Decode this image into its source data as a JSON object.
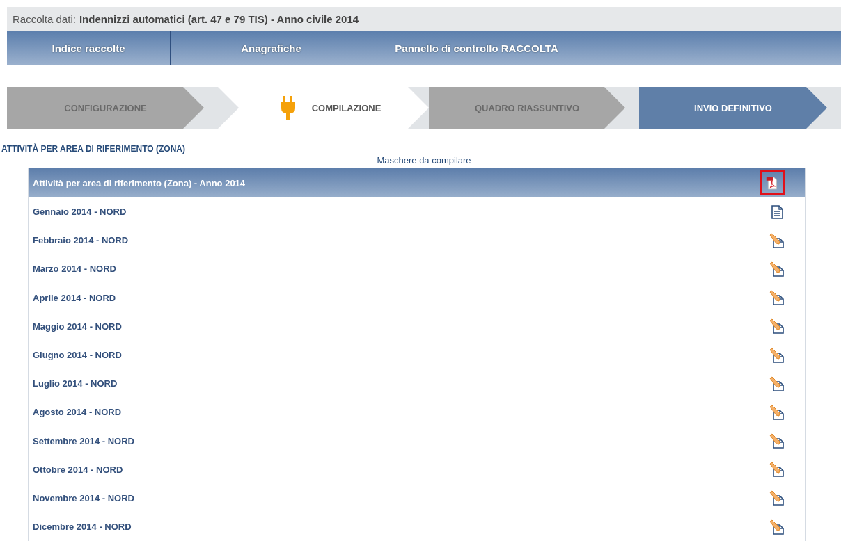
{
  "header": {
    "label": "Raccolta dati:",
    "title": "Indennizzi automatici (art. 47 e 79 TIS) - Anno civile 2014"
  },
  "nav": [
    {
      "label": "Indice raccolte"
    },
    {
      "label": "Anagrafiche"
    },
    {
      "label": "Pannello di controllo RACCOLTA"
    }
  ],
  "steps": [
    {
      "label": "CONFIGURAZIONE",
      "kind": "done"
    },
    {
      "label": "COMPILAZIONE",
      "kind": "current"
    },
    {
      "label": "QUADRO RIASSUNTIVO",
      "kind": "done"
    },
    {
      "label": "INVIO DEFINITIVO",
      "kind": "final"
    }
  ],
  "section_title": "ATTIVITÀ PER AREA DI RIFERIMENTO (ZONA)",
  "table": {
    "caption": "Maschere da compilare",
    "title": "Attività per area di riferimento (Zona) - Anno 2014",
    "highlighted": true,
    "rows": [
      {
        "label": "Gennaio 2014 - NORD",
        "kind": "view"
      },
      {
        "label": "Febbraio 2014 - NORD",
        "kind": "edit"
      },
      {
        "label": "Marzo 2014 - NORD",
        "kind": "edit"
      },
      {
        "label": "Aprile 2014 - NORD",
        "kind": "edit"
      },
      {
        "label": "Maggio 2014 - NORD",
        "kind": "edit"
      },
      {
        "label": "Giugno 2014 - NORD",
        "kind": "edit"
      },
      {
        "label": "Luglio 2014 - NORD",
        "kind": "edit"
      },
      {
        "label": "Agosto 2014 - NORD",
        "kind": "edit"
      },
      {
        "label": "Settembre 2014 - NORD",
        "kind": "edit"
      },
      {
        "label": "Ottobre 2014 - NORD",
        "kind": "edit"
      },
      {
        "label": "Novembre 2014 - NORD",
        "kind": "edit"
      },
      {
        "label": "Dicembre 2014 - NORD",
        "kind": "edit"
      }
    ]
  }
}
